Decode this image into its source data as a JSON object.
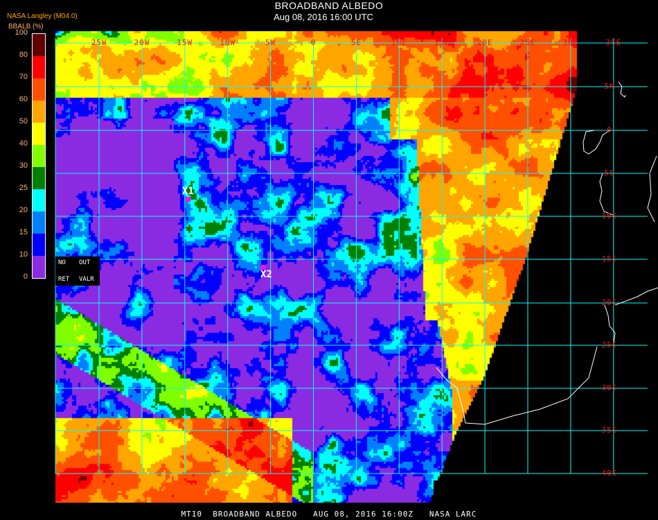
{
  "header": {
    "title": "BROADBAND ALBEDO",
    "subtitle": "Aug 08, 2016 16:00 UTC",
    "credit": "NASA Langley (M04.0)"
  },
  "colorbar": {
    "label": "BBALB (%)",
    "ticks": [
      "100",
      "80",
      "70",
      "60",
      "50",
      "40",
      "30",
      "25",
      "20",
      "15",
      "10",
      "0"
    ],
    "colors": [
      "#600000",
      "#ff0000",
      "#ff5000",
      "#ffa500",
      "#ffff00",
      "#80ff00",
      "#008000",
      "#00ffff",
      "#0080ff",
      "#0000ff",
      "#8a2be2"
    ]
  },
  "grid": {
    "color": "#00ffff",
    "lon_labels": [
      "25W",
      "20W",
      "15W",
      "10W",
      "5W",
      "0",
      "5E",
      "10E",
      "15E",
      "20E",
      "25E",
      "30E",
      "35E"
    ],
    "lat_labels": [
      "5N",
      "0",
      "5S",
      "10S",
      "15S",
      "20S",
      "25S",
      "30S",
      "35S",
      "40S"
    ],
    "label_color": "#ff1010"
  },
  "legend_box": {
    "no": "NO",
    "out": "OUT",
    "ret": "RET",
    "valr": "VALR"
  },
  "markers": [
    {
      "label": "X1",
      "color": "#ff10e0"
    },
    {
      "label": "X2",
      "color": "#ff10e0"
    }
  ],
  "footer": "MT10  BROADBAND ALBEDO   AUG 08, 2016 16:00Z   NASA LARC"
}
